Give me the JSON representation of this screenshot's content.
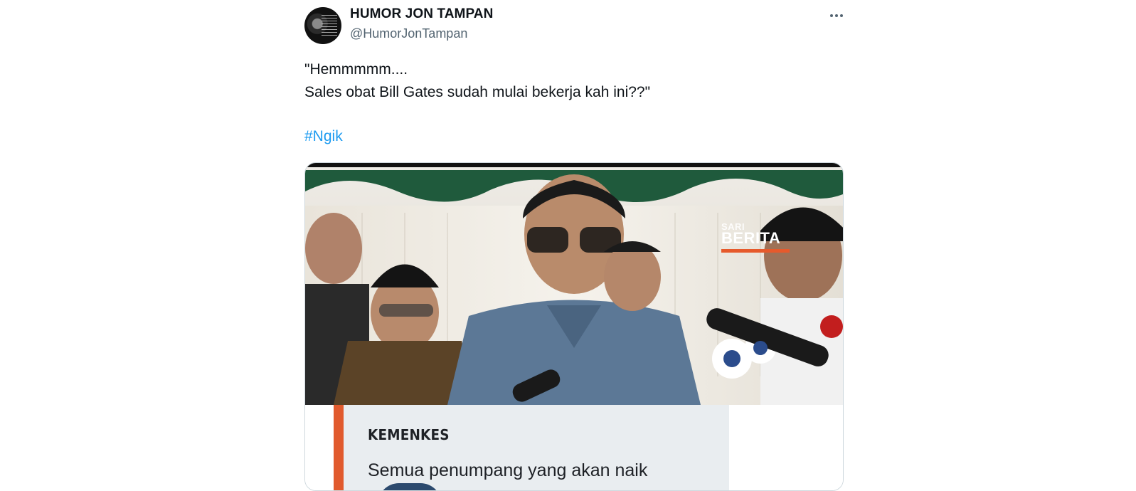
{
  "tweet": {
    "author": {
      "display_name": "HUMOR JON TAMPAN",
      "handle": "@HumorJonTampan"
    },
    "text": {
      "line1": "\"Hemmmmm....",
      "line2": "Sales obat Bill Gates sudah mulai bekerja kah ini??\"",
      "hashtag": "#Ngik"
    },
    "media": {
      "watermark_small": "SARI",
      "watermark_big": "BERITA",
      "card_kicker": "KEMENKES",
      "card_headline": "Semua penumpang yang akan naik"
    }
  },
  "colors": {
    "text_primary": "#0f1419",
    "text_secondary": "#536471",
    "link": "#1d9bf0",
    "border": "#cfd9de",
    "card_stripe": "#e15a2d",
    "card_bg": "#e9edf0"
  },
  "icons": {
    "more": "more-horizontal-icon"
  }
}
